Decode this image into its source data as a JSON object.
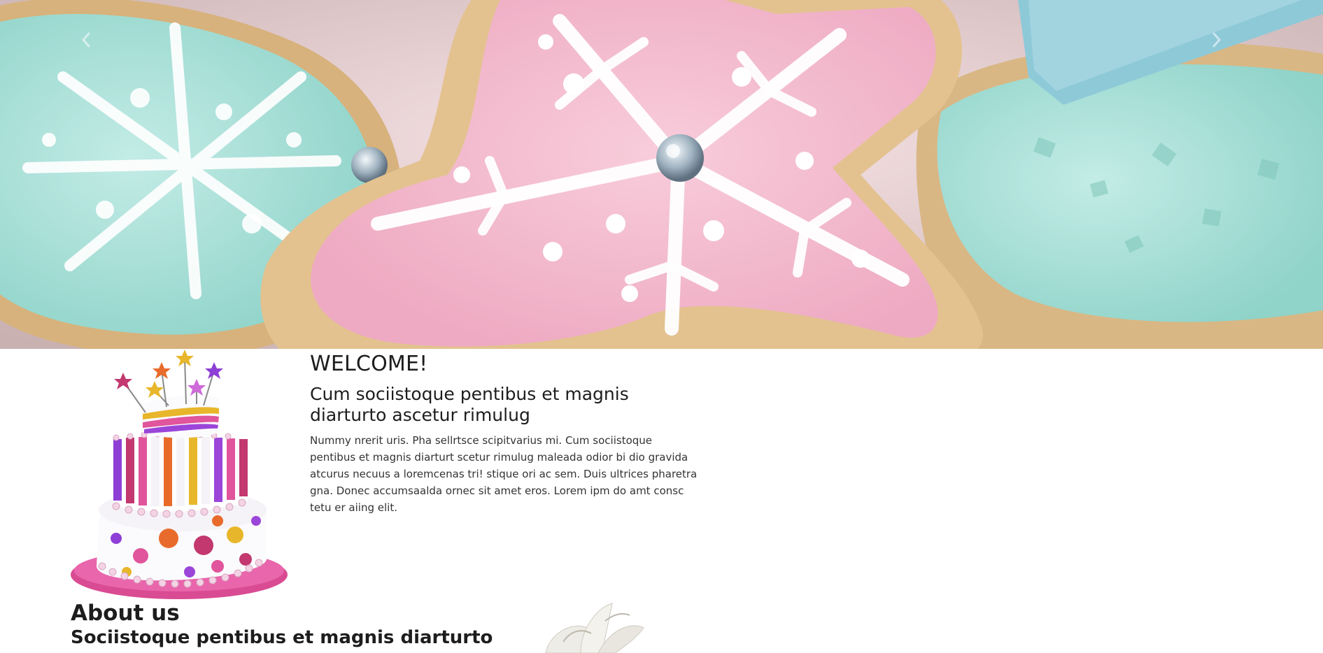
{
  "hero": {
    "prev_arrow_icon": "chevron-left-icon",
    "next_arrow_icon": "chevron-right-icon",
    "image": "decorated-star-cookies"
  },
  "welcome": {
    "image": "tiered-birthday-cake",
    "title": "WELCOME!",
    "subtitle": "Cum sociistoque pentibus et magnis diarturto ascetur rimulug",
    "body": "Nummy nrerit uris. Pha sellrtsce scipitvarius mi. Cum sociistoque pentibus et magnis diarturt scetur rimulug maleada odior bi dio gravida atcurus necuus a loremcenas tri! stique ori ac sem. Duis ultrices pharetra gna. Donec accumsaalda ornec sit amet eros. Lorem ipm do amt consc tetu er aiing elit."
  },
  "about": {
    "title": "About us",
    "subtitle": "Sociistoque pentibus et magnis diarturto",
    "image": "white-gift-bow"
  },
  "colors": {
    "cookie_pink": "#f3b8cb",
    "cookie_teal": "#a9e0d8",
    "cookie_dough": "#e2c08e",
    "icing_white": "#fbfbfb",
    "cake_magenta": "#e0559b"
  }
}
